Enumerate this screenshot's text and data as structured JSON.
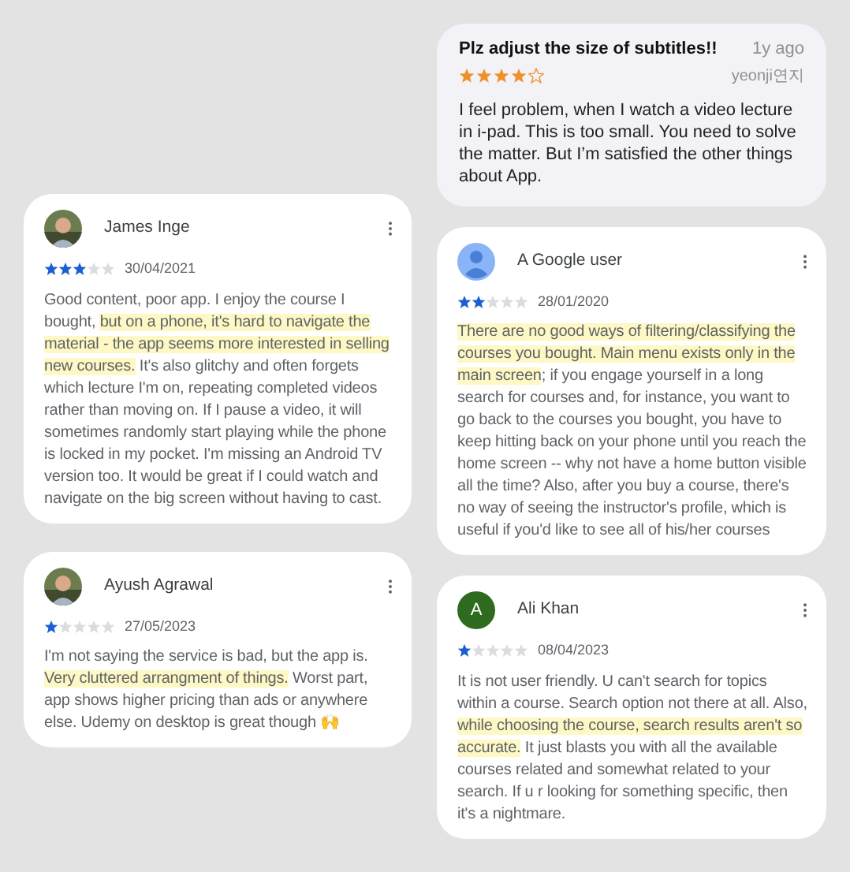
{
  "left_column": [
    {
      "kind": "google",
      "name": "James Inge",
      "stars": 3,
      "date": "30/04/2021",
      "text": [
        {
          "text": "Good content, poor app. I enjoy the course I bought, ",
          "highlighted": false
        },
        {
          "text": "but on a phone, it's hard to navigate the material - the app seems more interested in selling new courses.",
          "highlighted": true
        },
        {
          "text": " It's also glitchy and often forgets which lecture I'm on, repeating completed videos rather than moving on. If I pause a video, it will sometimes randomly start playing while the phone is locked in my pocket. I'm missing an Android TV version too. It would be great if I could watch and navigate on the big screen without having to cast.",
          "highlighted": false
        }
      ]
    },
    {
      "kind": "google",
      "name": "Ayush Agrawal",
      "stars": 1,
      "date": "27/05/2023",
      "text": [
        {
          "text": "I'm not saying the service is bad, but the app is. ",
          "highlighted": false
        },
        {
          "text": "Very cluttered arrangment of things.",
          "highlighted": true
        },
        {
          "text": " Worst part, app shows higher pricing than ads or anywhere else. Udemy on desktop is great though 🙌",
          "highlighted": false
        }
      ]
    }
  ],
  "right_column": [
    {
      "kind": "ios",
      "title": "Plz adjust the size of subtitles!!",
      "time": "1y ago",
      "stars": 4,
      "name": "yeonji연지",
      "text": [
        {
          "text": "I feel problem, when I watch a video lecture in i-pad. This is too small. You need to solve the matter. But I’m satisfied the other things about App.",
          "highlighted": false
        }
      ]
    },
    {
      "kind": "google",
      "avatar": {
        "kind": "silhouette"
      },
      "name": "A Google user",
      "stars": 2,
      "date": "28/01/2020",
      "text": [
        {
          "text": "There are no good ways of filtering/classifying the courses you bought. Main menu exists only in the main screen",
          "highlighted": true
        },
        {
          "text": "; if you engage yourself in a long search for courses and, for instance, you want to go back to the courses you bought, you have to keep hitting back on your phone until you reach the home screen -- why not have a home button visible all the time? Also, after you buy a course, there's no way of seeing the instructor's profile, which is useful if you'd like to see all of his/her courses",
          "highlighted": false
        }
      ]
    },
    {
      "kind": "google",
      "avatar": {
        "kind": "letter",
        "letter": "A",
        "color": "#2e6b1f"
      },
      "name": "Ali Khan",
      "stars": 1,
      "date": "08/04/2023",
      "text": [
        {
          "text": "It is not user friendly. U can't search for topics within a course. Search option not there at all. Also, ",
          "highlighted": false
        },
        {
          "text": "while choosing the course, search results aren't so accurate.",
          "highlighted": true
        },
        {
          "text": " It just blasts you with all the available courses related and somewhat related to your search. If u r looking for something specific, then it's a nightmare.",
          "highlighted": false
        }
      ]
    }
  ]
}
